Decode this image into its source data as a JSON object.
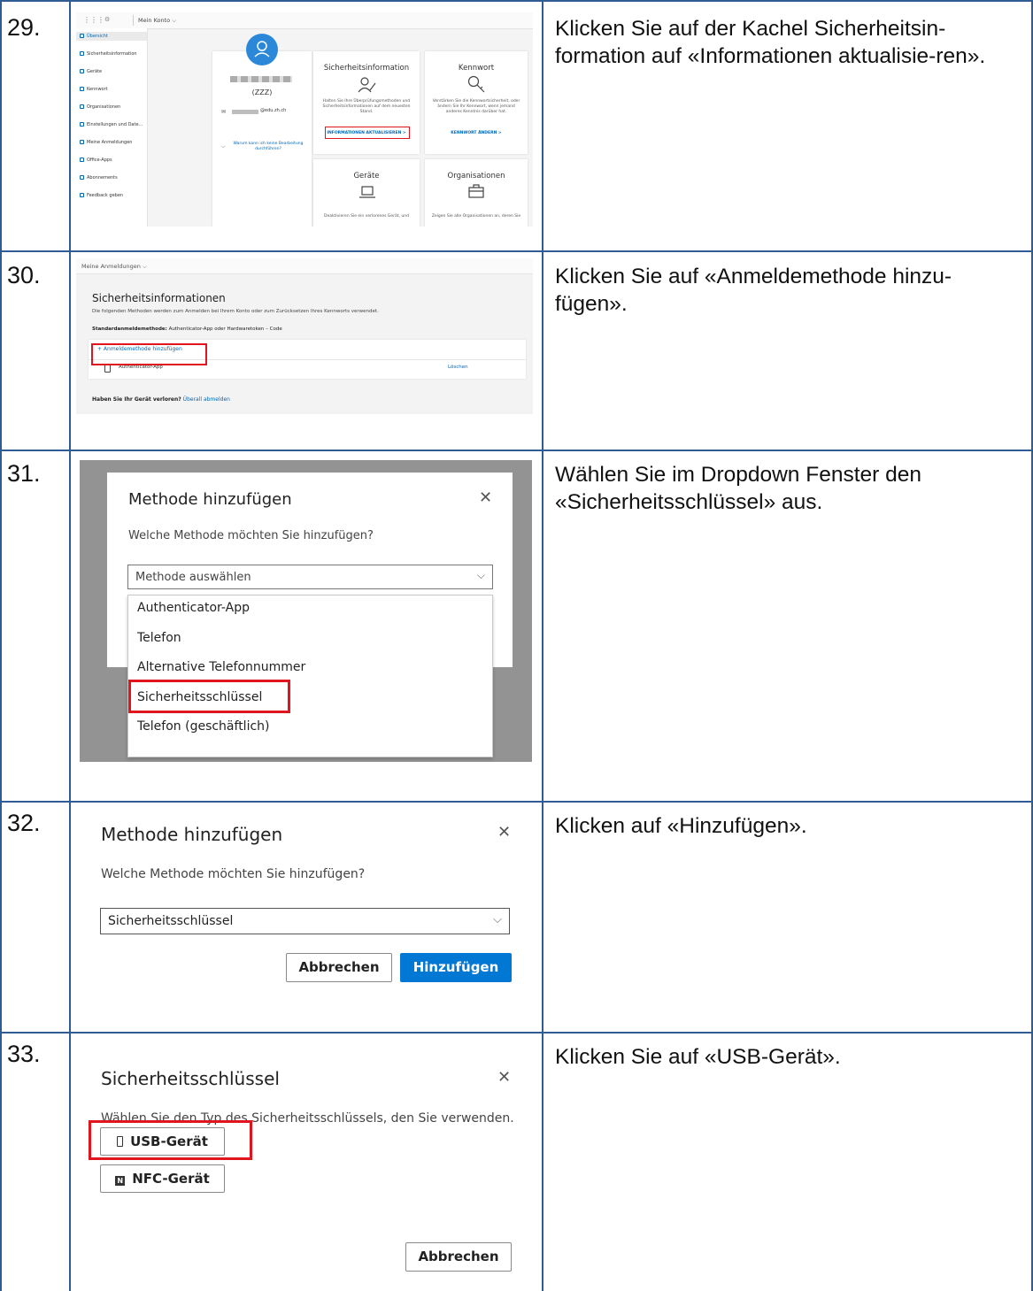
{
  "steps": [
    {
      "number": "29.",
      "instruction": "Klicken Sie auf der Kachel Sicherheitsin-formation auf «Informationen aktualisie-ren»."
    },
    {
      "number": "30.",
      "instruction": "Klicken Sie auf «Anmeldemethode hinzu-fügen»."
    },
    {
      "number": "31.",
      "instruction": "Wählen Sie im Dropdown Fenster den «Sicherheitsschlüssel» aus."
    },
    {
      "number": "32.",
      "instruction": "Klicken auf «Hinzufügen»."
    },
    {
      "number": "33.",
      "instruction": "Klicken Sie auf «USB-Gerät»."
    }
  ],
  "s29": {
    "breadcrumb": "Mein Konto",
    "nav": [
      "Übersicht",
      "Sicherheitsinformation",
      "Geräte",
      "Kennwort",
      "Organisationen",
      "Einstellungen und Date...",
      "Meine Anmeldungen",
      "Office-Apps",
      "Abonnements",
      "Feedback geben"
    ],
    "profile_name": "(ZZZ)",
    "profile_email": "@edu.zh.ch",
    "profile_link": "Warum kann ich keine Bearbeitung durchführen?",
    "card_security_title": "Sicherheitsinformation",
    "card_security_body": "Halten Sie Ihre Überprüfungsmethoden und Sicherheitsinformationen auf dem neuesten Stand.",
    "card_security_link": "INFORMATIONEN AKTUALISIEREN >",
    "card_password_title": "Kennwort",
    "card_password_body": "Verstärken Sie die Kennwortsicherheit, oder ändern Sie Ihr Kennwort, wenn jemand anderes Kenntnis darüber hat.",
    "card_password_link": "KENNWORT ÄNDERN >",
    "card_devices_title": "Geräte",
    "card_devices_body": "Deaktivieren Sie ein verlorenes Gerät, und",
    "card_orgs_title": "Organisationen",
    "card_orgs_body": "Zeigen Sie alle Organisationen an, deren Sie"
  },
  "s30": {
    "breadcrumb": "Meine Anmeldungen",
    "title": "Sicherheitsinformationen",
    "subtitle": "Die folgenden Methoden werden zum Anmelden bei Ihrem Konto oder zum Zurücksetzen Ihres Kennworts verwendet.",
    "default_label": "Standardanmeldemethode:",
    "default_value": "Authenticator-App oder Hardwaretoken – Code",
    "add_link": "+ Anmeldemethode hinzufügen",
    "method_name": "Authenticator-App",
    "delete": "Löschen",
    "lost_q": "Haben Sie Ihr Gerät verloren?",
    "lost_link": "Überall abmelden"
  },
  "s31": {
    "title": "Methode hinzufügen",
    "question": "Welche Methode möchten Sie hinzufügen?",
    "placeholder": "Methode auswählen",
    "options": [
      "Authenticator-App",
      "Telefon",
      "Alternative Telefonnummer",
      "Sicherheitsschlüssel",
      "Telefon (geschäftlich)"
    ]
  },
  "s32": {
    "title": "Methode hinzufügen",
    "question": "Welche Methode möchten Sie hinzufügen?",
    "selected": "Sicherheitsschlüssel",
    "cancel": "Abbrechen",
    "add": "Hinzufügen"
  },
  "s33": {
    "title": "Sicherheitsschlüssel",
    "prompt": "Wählen Sie den Typ des Sicherheitsschlüssels, den Sie verwenden.",
    "usb": "USB-Gerät",
    "nfc": "NFC-Gerät",
    "cancel": "Abbrechen"
  },
  "colors": {
    "border": "#2e5c93",
    "highlight": "#e0151d",
    "link": "#0067b8",
    "primary_button": "#0078d4"
  }
}
